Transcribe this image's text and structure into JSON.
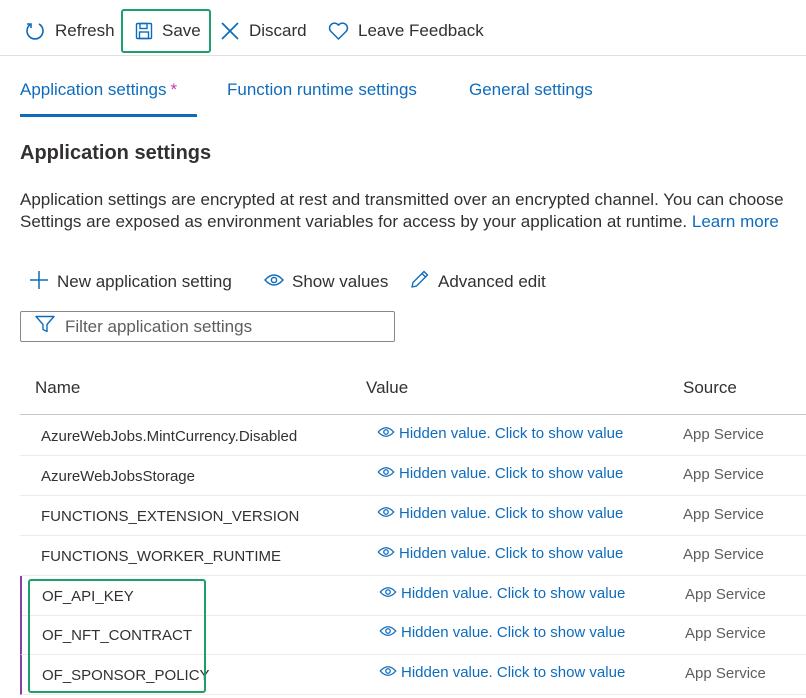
{
  "toolbar": {
    "refresh_label": "Refresh",
    "save_label": "Save",
    "discard_label": "Discard",
    "feedback_label": "Leave Feedback"
  },
  "tabs": [
    {
      "label": "Application settings",
      "active": true,
      "modified": true,
      "marker": "*"
    },
    {
      "label": "Function runtime settings",
      "active": false
    },
    {
      "label": "General settings",
      "active": false
    }
  ],
  "section": {
    "title": "Application settings",
    "description_line1": "Application settings are encrypted at rest and transmitted over an encrypted channel. You can choose",
    "description_line2": "Settings are exposed as environment variables for access by your application at runtime.",
    "learn_more": "Learn more"
  },
  "commands": {
    "new_label": "New application setting",
    "show_label": "Show values",
    "advanced_label": "Advanced edit"
  },
  "filter": {
    "placeholder": "Filter application settings",
    "value": ""
  },
  "table": {
    "columns": [
      "Name",
      "Value",
      "Source"
    ],
    "rows": [
      {
        "name": "AzureWebJobs.MintCurrency.Disabled",
        "value": "Hidden value. Click to show value",
        "source": "App Service"
      },
      {
        "name": "AzureWebJobsStorage",
        "value": "Hidden value. Click to show value",
        "source": "App Service"
      },
      {
        "name": "FUNCTIONS_EXTENSION_VERSION",
        "value": "Hidden value. Click to show value",
        "source": "App Service"
      },
      {
        "name": "FUNCTIONS_WORKER_RUNTIME",
        "value": "Hidden value. Click to show value",
        "source": "App Service"
      },
      {
        "name": "OF_API_KEY",
        "value": "Hidden value. Click to show value",
        "source": "App Service"
      },
      {
        "name": "OF_NFT_CONTRACT",
        "value": "Hidden value. Click to show value",
        "source": "App Service"
      },
      {
        "name": "OF_SPONSOR_POLICY",
        "value": "Hidden value. Click to show value",
        "source": "App Service"
      }
    ]
  },
  "colors": {
    "accent": "#0f6cbd",
    "highlight": "#1e9e6a",
    "modified_marker": "#c239b3",
    "new_row_bar": "#8a3fa6"
  },
  "icons": [
    "refresh-icon",
    "save-icon",
    "discard-icon",
    "heart-icon",
    "add-icon",
    "eye-icon",
    "edit-icon",
    "filter-icon"
  ]
}
